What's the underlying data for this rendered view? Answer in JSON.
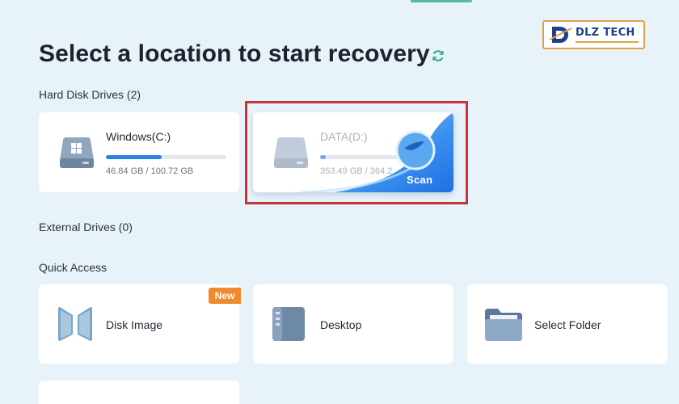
{
  "header": {
    "title": "Select a location to start recovery",
    "logo_text": "DLZ TECH"
  },
  "hard_disk_drives": {
    "label": "Hard Disk Drives (2)",
    "drives": [
      {
        "name": "Windows(C:)",
        "size": "46.84 GB / 100.72 GB",
        "used_fraction": 0.465
      },
      {
        "name": "DATA(D:)",
        "size": "353.49 GB / 364.2",
        "used_fraction": 0.05,
        "action": "Scan"
      }
    ]
  },
  "external_drives": {
    "label": "External Drives (0)"
  },
  "quick_access": {
    "label": "Quick Access",
    "items": [
      {
        "label": "Disk Image",
        "badge": "New"
      },
      {
        "label": "Desktop"
      },
      {
        "label": "Select Folder"
      }
    ]
  },
  "colors": {
    "accent": "#2f7fe0",
    "highlight": "#c8323a",
    "badge": "#f08a2c",
    "background": "#e7f2f9"
  },
  "icons": [
    "refresh-icon",
    "hard-drive-icon",
    "disk-image-icon",
    "desktop-icon",
    "folder-icon",
    "logo-icon"
  ]
}
